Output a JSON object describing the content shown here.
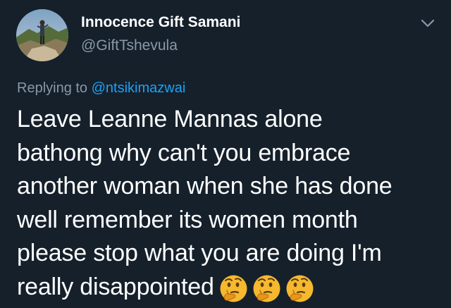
{
  "tweet": {
    "display_name": "Innocence Gift Samani",
    "handle": "@GiftTshevula",
    "reply_prefix": "Replying to",
    "reply_to": "@ntsikimazwai",
    "text_lines": [
      "Leave Leanne Mannas alone",
      "bathong why can't you embrace",
      "another woman when she has done",
      "well remember its women month",
      "please stop what you are doing I'm",
      "really disappointed"
    ],
    "emojis": [
      "thinking-face-icon",
      "thinking-face-icon",
      "thinking-face-icon"
    ]
  },
  "colors": {
    "background": "#15202b",
    "primary_text": "#ffffff",
    "secondary_text": "#8899a6",
    "link": "#1da1f2"
  },
  "icons": {
    "avatar": "profile-photo",
    "menu": "chevron-down-icon"
  }
}
